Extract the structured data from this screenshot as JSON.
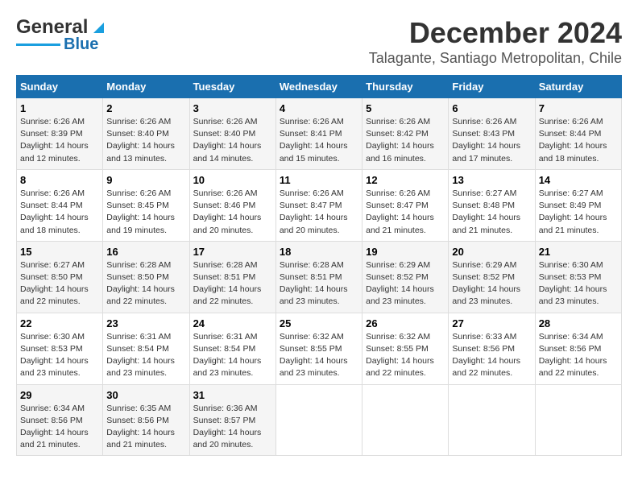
{
  "logo": {
    "line1": "General",
    "line2": "Blue"
  },
  "title": "December 2024",
  "subtitle": "Talagante, Santiago Metropolitan, Chile",
  "days_header": [
    "Sunday",
    "Monday",
    "Tuesday",
    "Wednesday",
    "Thursday",
    "Friday",
    "Saturday"
  ],
  "weeks": [
    [
      {
        "day": "1",
        "sunrise": "Sunrise: 6:26 AM",
        "sunset": "Sunset: 8:39 PM",
        "daylight": "Daylight: 14 hours and 12 minutes."
      },
      {
        "day": "2",
        "sunrise": "Sunrise: 6:26 AM",
        "sunset": "Sunset: 8:40 PM",
        "daylight": "Daylight: 14 hours and 13 minutes."
      },
      {
        "day": "3",
        "sunrise": "Sunrise: 6:26 AM",
        "sunset": "Sunset: 8:40 PM",
        "daylight": "Daylight: 14 hours and 14 minutes."
      },
      {
        "day": "4",
        "sunrise": "Sunrise: 6:26 AM",
        "sunset": "Sunset: 8:41 PM",
        "daylight": "Daylight: 14 hours and 15 minutes."
      },
      {
        "day": "5",
        "sunrise": "Sunrise: 6:26 AM",
        "sunset": "Sunset: 8:42 PM",
        "daylight": "Daylight: 14 hours and 16 minutes."
      },
      {
        "day": "6",
        "sunrise": "Sunrise: 6:26 AM",
        "sunset": "Sunset: 8:43 PM",
        "daylight": "Daylight: 14 hours and 17 minutes."
      },
      {
        "day": "7",
        "sunrise": "Sunrise: 6:26 AM",
        "sunset": "Sunset: 8:44 PM",
        "daylight": "Daylight: 14 hours and 18 minutes."
      }
    ],
    [
      {
        "day": "8",
        "sunrise": "Sunrise: 6:26 AM",
        "sunset": "Sunset: 8:44 PM",
        "daylight": "Daylight: 14 hours and 18 minutes."
      },
      {
        "day": "9",
        "sunrise": "Sunrise: 6:26 AM",
        "sunset": "Sunset: 8:45 PM",
        "daylight": "Daylight: 14 hours and 19 minutes."
      },
      {
        "day": "10",
        "sunrise": "Sunrise: 6:26 AM",
        "sunset": "Sunset: 8:46 PM",
        "daylight": "Daylight: 14 hours and 20 minutes."
      },
      {
        "day": "11",
        "sunrise": "Sunrise: 6:26 AM",
        "sunset": "Sunset: 8:47 PM",
        "daylight": "Daylight: 14 hours and 20 minutes."
      },
      {
        "day": "12",
        "sunrise": "Sunrise: 6:26 AM",
        "sunset": "Sunset: 8:47 PM",
        "daylight": "Daylight: 14 hours and 21 minutes."
      },
      {
        "day": "13",
        "sunrise": "Sunrise: 6:27 AM",
        "sunset": "Sunset: 8:48 PM",
        "daylight": "Daylight: 14 hours and 21 minutes."
      },
      {
        "day": "14",
        "sunrise": "Sunrise: 6:27 AM",
        "sunset": "Sunset: 8:49 PM",
        "daylight": "Daylight: 14 hours and 21 minutes."
      }
    ],
    [
      {
        "day": "15",
        "sunrise": "Sunrise: 6:27 AM",
        "sunset": "Sunset: 8:50 PM",
        "daylight": "Daylight: 14 hours and 22 minutes."
      },
      {
        "day": "16",
        "sunrise": "Sunrise: 6:28 AM",
        "sunset": "Sunset: 8:50 PM",
        "daylight": "Daylight: 14 hours and 22 minutes."
      },
      {
        "day": "17",
        "sunrise": "Sunrise: 6:28 AM",
        "sunset": "Sunset: 8:51 PM",
        "daylight": "Daylight: 14 hours and 22 minutes."
      },
      {
        "day": "18",
        "sunrise": "Sunrise: 6:28 AM",
        "sunset": "Sunset: 8:51 PM",
        "daylight": "Daylight: 14 hours and 23 minutes."
      },
      {
        "day": "19",
        "sunrise": "Sunrise: 6:29 AM",
        "sunset": "Sunset: 8:52 PM",
        "daylight": "Daylight: 14 hours and 23 minutes."
      },
      {
        "day": "20",
        "sunrise": "Sunrise: 6:29 AM",
        "sunset": "Sunset: 8:52 PM",
        "daylight": "Daylight: 14 hours and 23 minutes."
      },
      {
        "day": "21",
        "sunrise": "Sunrise: 6:30 AM",
        "sunset": "Sunset: 8:53 PM",
        "daylight": "Daylight: 14 hours and 23 minutes."
      }
    ],
    [
      {
        "day": "22",
        "sunrise": "Sunrise: 6:30 AM",
        "sunset": "Sunset: 8:53 PM",
        "daylight": "Daylight: 14 hours and 23 minutes."
      },
      {
        "day": "23",
        "sunrise": "Sunrise: 6:31 AM",
        "sunset": "Sunset: 8:54 PM",
        "daylight": "Daylight: 14 hours and 23 minutes."
      },
      {
        "day": "24",
        "sunrise": "Sunrise: 6:31 AM",
        "sunset": "Sunset: 8:54 PM",
        "daylight": "Daylight: 14 hours and 23 minutes."
      },
      {
        "day": "25",
        "sunrise": "Sunrise: 6:32 AM",
        "sunset": "Sunset: 8:55 PM",
        "daylight": "Daylight: 14 hours and 23 minutes."
      },
      {
        "day": "26",
        "sunrise": "Sunrise: 6:32 AM",
        "sunset": "Sunset: 8:55 PM",
        "daylight": "Daylight: 14 hours and 22 minutes."
      },
      {
        "day": "27",
        "sunrise": "Sunrise: 6:33 AM",
        "sunset": "Sunset: 8:56 PM",
        "daylight": "Daylight: 14 hours and 22 minutes."
      },
      {
        "day": "28",
        "sunrise": "Sunrise: 6:34 AM",
        "sunset": "Sunset: 8:56 PM",
        "daylight": "Daylight: 14 hours and 22 minutes."
      }
    ],
    [
      {
        "day": "29",
        "sunrise": "Sunrise: 6:34 AM",
        "sunset": "Sunset: 8:56 PM",
        "daylight": "Daylight: 14 hours and 21 minutes."
      },
      {
        "day": "30",
        "sunrise": "Sunrise: 6:35 AM",
        "sunset": "Sunset: 8:56 PM",
        "daylight": "Daylight: 14 hours and 21 minutes."
      },
      {
        "day": "31",
        "sunrise": "Sunrise: 6:36 AM",
        "sunset": "Sunset: 8:57 PM",
        "daylight": "Daylight: 14 hours and 20 minutes."
      },
      null,
      null,
      null,
      null
    ]
  ]
}
